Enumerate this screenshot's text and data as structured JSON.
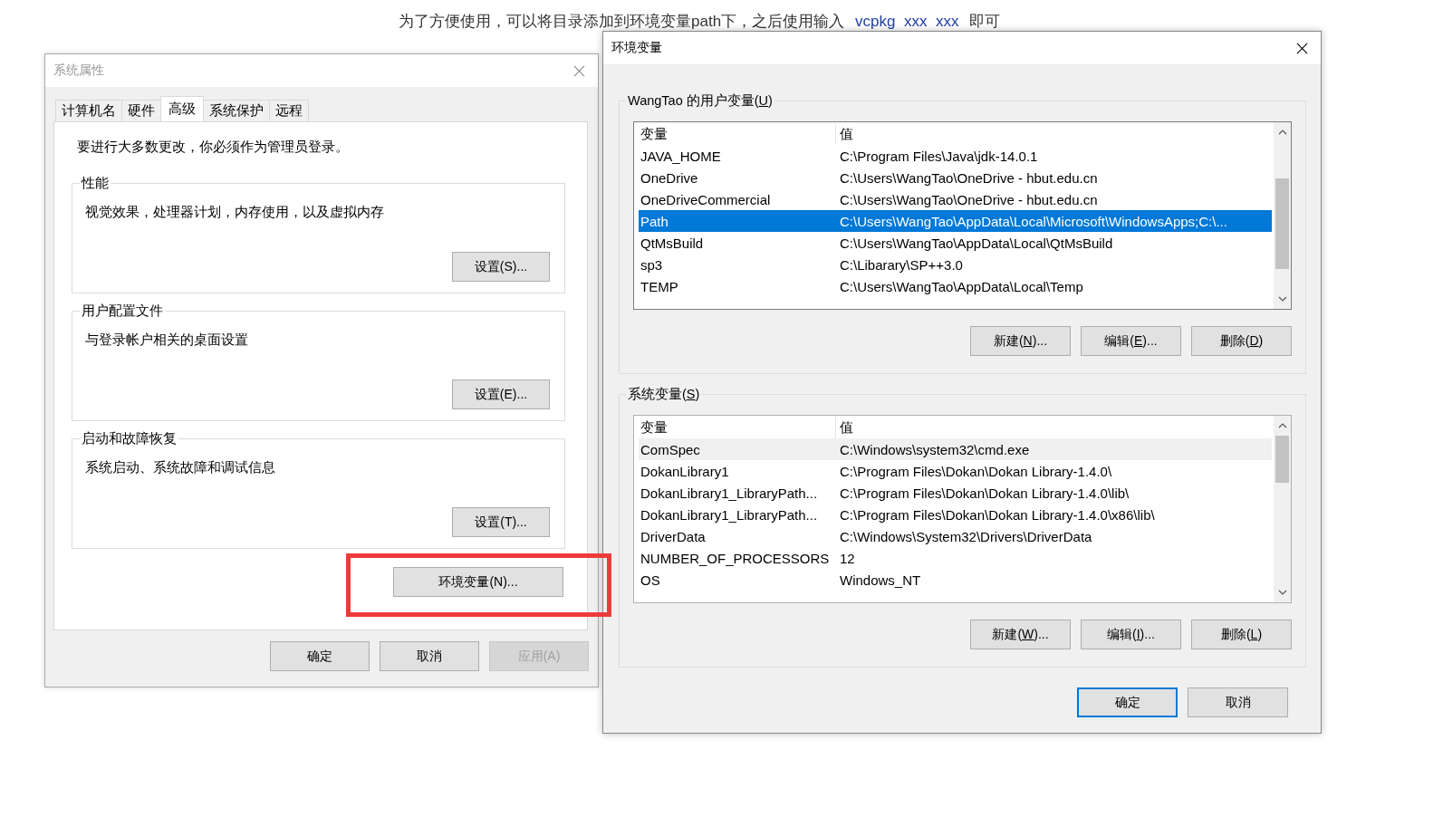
{
  "note": {
    "before": "为了方便使用，可以将目录添加到环境变量path下，之后使用输入",
    "code": "vcpkg  xxx  xxx",
    "after": "即可"
  },
  "system_properties": {
    "title": "系统属性",
    "active": false,
    "tabs": [
      {
        "label": "计算机名",
        "selected": false
      },
      {
        "label": "硬件",
        "selected": false
      },
      {
        "label": "高级",
        "selected": true
      },
      {
        "label": "系统保护",
        "selected": false
      },
      {
        "label": "远程",
        "selected": false
      }
    ],
    "admin_notice": "要进行大多数更改，你必须作为管理员登录。",
    "groups": [
      {
        "title": "性能",
        "description": "视觉效果，处理器计划，内存使用，以及虚拟内存",
        "button": "设置(S)..."
      },
      {
        "title": "用户配置文件",
        "description": "与登录帐户相关的桌面设置",
        "button": "设置(E)..."
      },
      {
        "title": "启动和故障恢复",
        "description": "系统启动、系统故障和调试信息",
        "button": "设置(T)..."
      }
    ],
    "env_button": "环境变量(N)...",
    "buttons": [
      {
        "label": "确定",
        "disabled": false
      },
      {
        "label": "取消",
        "disabled": false
      },
      {
        "label": "应用(A)",
        "disabled": true
      }
    ]
  },
  "env_dialog": {
    "title": "环境变量",
    "active": true,
    "sections": [
      {
        "title": {
          "pre": "WangTao 的用户变量(",
          "key": "U",
          "post": ")"
        },
        "focused": true,
        "columns": [
          "变量",
          "值"
        ],
        "rows": [
          {
            "name": "JAVA_HOME",
            "value": "C:\\Program Files\\Java\\jdk-14.0.1",
            "selected": false
          },
          {
            "name": "OneDrive",
            "value": "C:\\Users\\WangTao\\OneDrive - hbut.edu.cn",
            "selected": false
          },
          {
            "name": "OneDriveCommercial",
            "value": "C:\\Users\\WangTao\\OneDrive - hbut.edu.cn",
            "selected": false
          },
          {
            "name": "Path",
            "value": "C:\\Users\\WangTao\\AppData\\Local\\Microsoft\\WindowsApps;C:\\...",
            "selected": true
          },
          {
            "name": "QtMsBuild",
            "value": "C:\\Users\\WangTao\\AppData\\Local\\QtMsBuild",
            "selected": false
          },
          {
            "name": "sp3",
            "value": "C:\\Libarary\\SP++3.0",
            "selected": false
          },
          {
            "name": "TEMP",
            "value": "C:\\Users\\WangTao\\AppData\\Local\\Temp",
            "selected": false
          }
        ],
        "buttons": [
          {
            "pre": "新建(",
            "key": "N",
            "post": ")..."
          },
          {
            "pre": "编辑(",
            "key": "E",
            "post": ")..."
          },
          {
            "pre": "删除(",
            "key": "D",
            "post": ")"
          }
        ]
      },
      {
        "title": {
          "pre": "系统变量(",
          "key": "S",
          "post": ")"
        },
        "focused": false,
        "columns": [
          "变量",
          "值"
        ],
        "rows": [
          {
            "name": "ComSpec",
            "value": "C:\\Windows\\system32\\cmd.exe",
            "selected": true
          },
          {
            "name": "DokanLibrary1",
            "value": "C:\\Program Files\\Dokan\\Dokan Library-1.4.0\\",
            "selected": false
          },
          {
            "name": "DokanLibrary1_LibraryPath...",
            "value": "C:\\Program Files\\Dokan\\Dokan Library-1.4.0\\lib\\",
            "selected": false
          },
          {
            "name": "DokanLibrary1_LibraryPath...",
            "value": "C:\\Program Files\\Dokan\\Dokan Library-1.4.0\\x86\\lib\\",
            "selected": false
          },
          {
            "name": "DriverData",
            "value": "C:\\Windows\\System32\\Drivers\\DriverData",
            "selected": false
          },
          {
            "name": "NUMBER_OF_PROCESSORS",
            "value": "12",
            "selected": false
          },
          {
            "name": "OS",
            "value": "Windows_NT",
            "selected": false
          }
        ],
        "buttons": [
          {
            "pre": "新建(",
            "key": "W",
            "post": ")..."
          },
          {
            "pre": "编辑(",
            "key": "I",
            "post": ")..."
          },
          {
            "pre": "删除(",
            "key": "L",
            "post": ")"
          }
        ]
      }
    ],
    "buttons": [
      {
        "label": "确定",
        "default": true
      },
      {
        "label": "取消",
        "default": false
      }
    ]
  }
}
